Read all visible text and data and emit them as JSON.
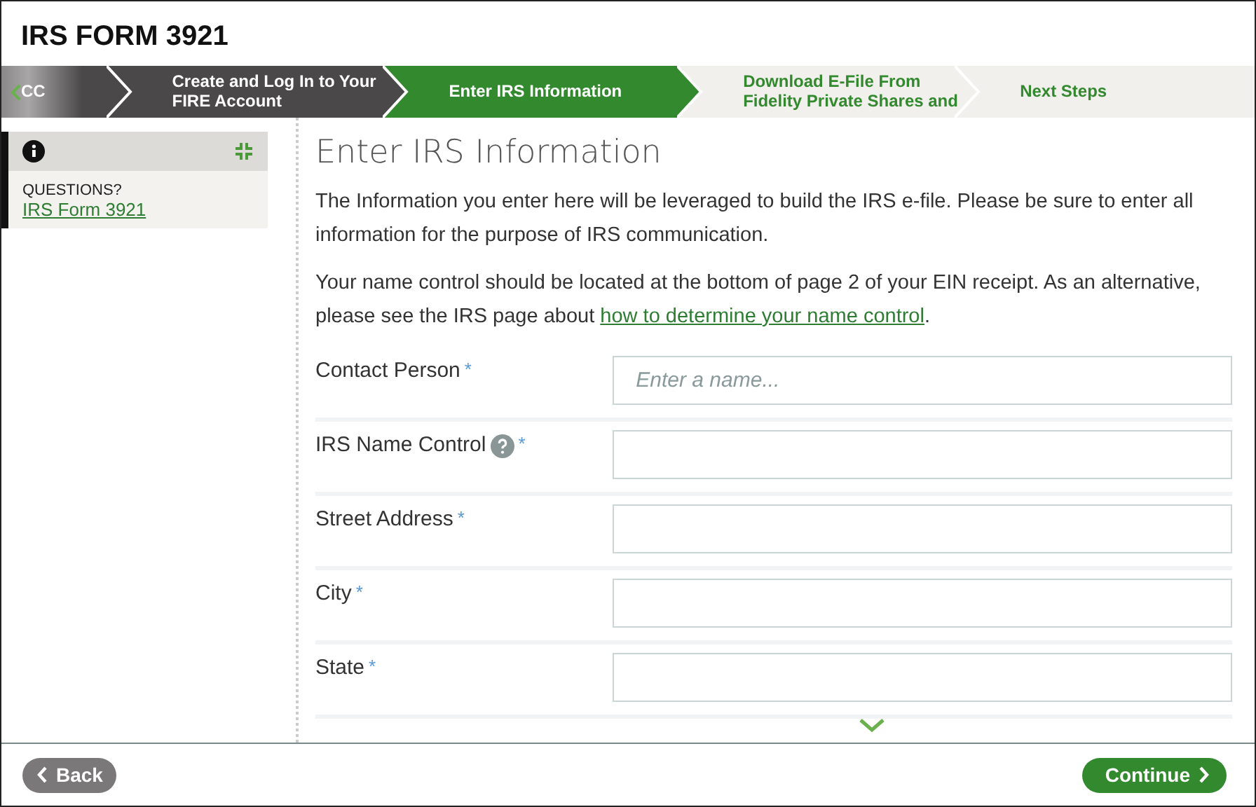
{
  "title": "IRS FORM 3921",
  "steps": [
    {
      "label": "CC",
      "completed": true,
      "selected": false
    },
    {
      "label": "Create and Log In to Your FIRE Account",
      "completed": true,
      "selected": false
    },
    {
      "label": "Enter IRS Information",
      "completed": false,
      "selected": true
    },
    {
      "label": "Download E-File From Fidelity Private Shares and",
      "completed": false,
      "selected": false
    },
    {
      "label": "Next Steps",
      "completed": false,
      "selected": false
    }
  ],
  "sidebar": {
    "heading": "QUESTIONS?",
    "link": "IRS Form 3921"
  },
  "content": {
    "heading": "Enter IRS Information",
    "paragraphs": [
      {
        "text": "The Information you enter here will be leveraged to build the IRS e-file. Please be sure to enter all information for the purpose of IRS communication."
      },
      {
        "text": "Your name control should be located at the bottom of page 2 of your EIN receipt. As an alternative, please see the IRS page about ",
        "link": "how to determine your name control",
        "after": "."
      }
    ],
    "fields": [
      {
        "label": "Contact Person",
        "required_mark": "*",
        "help": false,
        "placeholder": "Enter a name..."
      },
      {
        "label": "IRS Name Control",
        "required_mark": "*",
        "help": true
      },
      {
        "label": "Street Address",
        "required_mark": "*",
        "help": false
      },
      {
        "label": "City",
        "required_mark": "*",
        "help": false
      },
      {
        "label": "State",
        "required_mark": "*",
        "help": false
      }
    ]
  },
  "footer": {
    "back": "Back",
    "continue": "Continue"
  }
}
